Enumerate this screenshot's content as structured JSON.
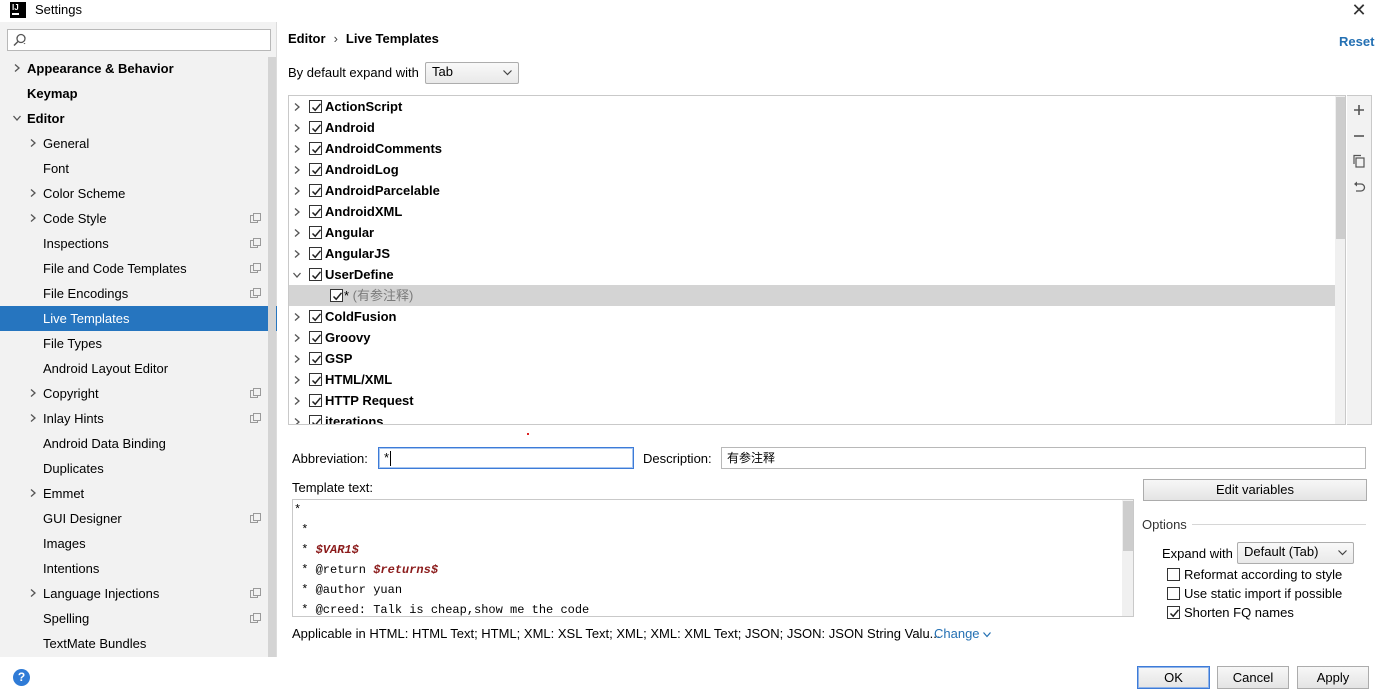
{
  "window": {
    "title": "Settings"
  },
  "search": {
    "placeholder": ""
  },
  "sidebar": {
    "items": [
      {
        "label": "Appearance & Behavior",
        "level": 0,
        "chevron": "right"
      },
      {
        "label": "Keymap",
        "level": 0,
        "chevron": "none"
      },
      {
        "label": "Editor",
        "level": 0,
        "chevron": "down"
      },
      {
        "label": "General",
        "level": 1,
        "chevron": "right"
      },
      {
        "label": "Font",
        "level": 1,
        "chevron": "none"
      },
      {
        "label": "Color Scheme",
        "level": 1,
        "chevron": "right"
      },
      {
        "label": "Code Style",
        "level": 1,
        "chevron": "right",
        "project": true
      },
      {
        "label": "Inspections",
        "level": 1,
        "chevron": "none",
        "project": true
      },
      {
        "label": "File and Code Templates",
        "level": 1,
        "chevron": "none",
        "project": true
      },
      {
        "label": "File Encodings",
        "level": 1,
        "chevron": "none",
        "project": true
      },
      {
        "label": "Live Templates",
        "level": 1,
        "chevron": "none",
        "selected": true
      },
      {
        "label": "File Types",
        "level": 1,
        "chevron": "none"
      },
      {
        "label": "Android Layout Editor",
        "level": 1,
        "chevron": "none"
      },
      {
        "label": "Copyright",
        "level": 1,
        "chevron": "right",
        "project": true
      },
      {
        "label": "Inlay Hints",
        "level": 1,
        "chevron": "right",
        "project": true
      },
      {
        "label": "Android Data Binding",
        "level": 1,
        "chevron": "none"
      },
      {
        "label": "Duplicates",
        "level": 1,
        "chevron": "none"
      },
      {
        "label": "Emmet",
        "level": 1,
        "chevron": "right"
      },
      {
        "label": "GUI Designer",
        "level": 1,
        "chevron": "none",
        "project": true
      },
      {
        "label": "Images",
        "level": 1,
        "chevron": "none"
      },
      {
        "label": "Intentions",
        "level": 1,
        "chevron": "none"
      },
      {
        "label": "Language Injections",
        "level": 1,
        "chevron": "right",
        "project": true
      },
      {
        "label": "Spelling",
        "level": 1,
        "chevron": "none",
        "project": true
      },
      {
        "label": "TextMate Bundles",
        "level": 1,
        "chevron": "none"
      }
    ]
  },
  "header": {
    "breadcrumb_parent": "Editor",
    "breadcrumb_separator": "›",
    "breadcrumb_current": "Live Templates",
    "reset_label": "Reset"
  },
  "expand_default": {
    "label": "By default expand with",
    "value": "Tab"
  },
  "template_groups": [
    {
      "name": "ActionScript",
      "checked": true,
      "expanded": false
    },
    {
      "name": "Android",
      "checked": true,
      "expanded": false
    },
    {
      "name": "AndroidComments",
      "checked": true,
      "expanded": false
    },
    {
      "name": "AndroidLog",
      "checked": true,
      "expanded": false
    },
    {
      "name": "AndroidParcelable",
      "checked": true,
      "expanded": false
    },
    {
      "name": "AndroidXML",
      "checked": true,
      "expanded": false
    },
    {
      "name": "Angular",
      "checked": true,
      "expanded": false
    },
    {
      "name": "AngularJS",
      "checked": true,
      "expanded": false
    },
    {
      "name": "UserDefine",
      "checked": true,
      "expanded": true,
      "children": [
        {
          "abbr": "*",
          "desc": " (有参注释)",
          "checked": true,
          "selected": true
        }
      ]
    },
    {
      "name": "ColdFusion",
      "checked": true,
      "expanded": false
    },
    {
      "name": "Groovy",
      "checked": true,
      "expanded": false
    },
    {
      "name": "GSP",
      "checked": true,
      "expanded": false
    },
    {
      "name": "HTML/XML",
      "checked": true,
      "expanded": false
    },
    {
      "name": "HTTP Request",
      "checked": true,
      "expanded": false
    },
    {
      "name": "iterations",
      "checked": true,
      "expanded": false
    }
  ],
  "toolbar": {
    "icons": [
      "add-icon",
      "remove-icon",
      "copy-icon",
      "restore-icon"
    ]
  },
  "details": {
    "abbreviation_label": "Abbreviation:",
    "abbreviation_value": "*",
    "description_label": "Description:",
    "description_value": "有参注释",
    "template_text_label": "Template text:",
    "template_lines": [
      [
        {
          "t": "*"
        }
      ],
      [
        {
          "t": " *"
        }
      ],
      [
        {
          "t": " * "
        },
        {
          "t": "$VAR1$",
          "var": true
        }
      ],
      [
        {
          "t": " * @return "
        },
        {
          "t": "$returns$",
          "var": true
        }
      ],
      [
        {
          "t": " * @author yuan"
        }
      ],
      [
        {
          "t": " * @creed: Talk is cheap,show me the code"
        }
      ]
    ],
    "applicable_text": "Applicable in HTML: HTML Text; HTML; XML: XSL Text; XML; XML: XML Text; JSON; JSON: JSON String Valu...",
    "change_label": "Change"
  },
  "options": {
    "edit_variables_label": "Edit variables",
    "title": "Options",
    "expand_with_label": "Expand with",
    "expand_with_value": "Default (Tab)",
    "checkboxes": [
      {
        "label": "Reformat according to style",
        "checked": false
      },
      {
        "label": "Use static import if possible",
        "checked": false
      },
      {
        "label": "Shorten FQ names",
        "checked": true
      }
    ]
  },
  "footer": {
    "help_label": "?",
    "ok_label": "OK",
    "cancel_label": "Cancel",
    "apply_label": "Apply"
  },
  "colors": {
    "selection": "#2675bf",
    "link": "#2470b3",
    "variable": "#8b1b1b"
  }
}
